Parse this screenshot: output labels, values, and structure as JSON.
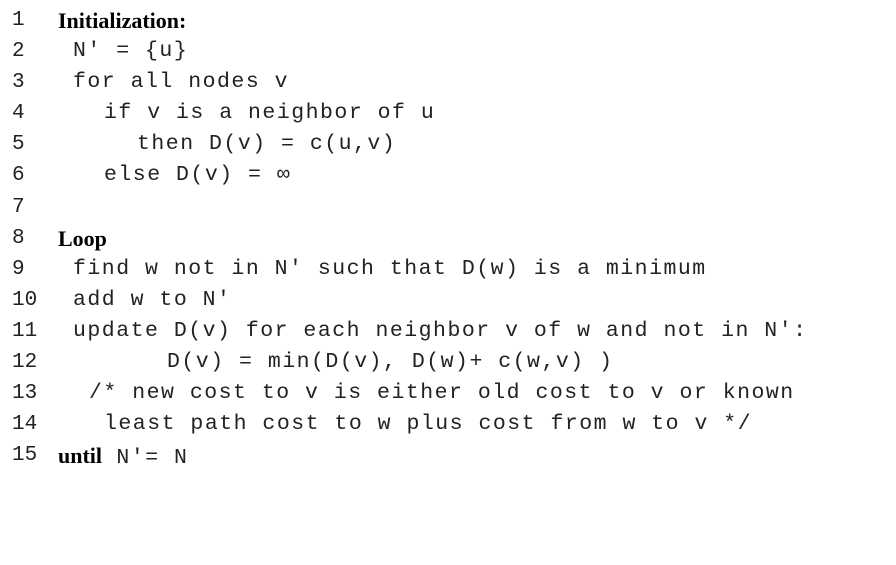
{
  "listing": {
    "lines": [
      {
        "num": "1",
        "keyword": "Initialization:",
        "text": ""
      },
      {
        "num": "2",
        "keyword": "",
        "text": "N′ = {u}"
      },
      {
        "num": "3",
        "keyword": "",
        "text": "for all nodes v"
      },
      {
        "num": "4",
        "keyword": "",
        "text": "if v is a neighbor of u"
      },
      {
        "num": "5",
        "keyword": "",
        "text": "then D(v) = c(u,v)"
      },
      {
        "num": "6",
        "keyword": "",
        "text": "else D(v) = ∞"
      },
      {
        "num": "7",
        "keyword": "",
        "text": ""
      },
      {
        "num": "8",
        "keyword": "Loop",
        "text": ""
      },
      {
        "num": "9",
        "keyword": "",
        "text": "find w not in N′ such that D(w) is a minimum"
      },
      {
        "num": "10",
        "keyword": "",
        "text": "add w to N′"
      },
      {
        "num": "11",
        "keyword": "",
        "text": "update D(v) for each neighbor v of w and not in N′:"
      },
      {
        "num": "12",
        "keyword": "",
        "text": "D(v) = min(D(v), D(w)+ c(w,v) )"
      },
      {
        "num": "13",
        "keyword": "",
        "text": "/* new cost to v is either old cost to v or known"
      },
      {
        "num": "14",
        "keyword": "",
        "text": "least path cost to w plus cost from w to v */"
      },
      {
        "num": "15",
        "keyword": "until",
        "text": " N′= N"
      }
    ]
  }
}
